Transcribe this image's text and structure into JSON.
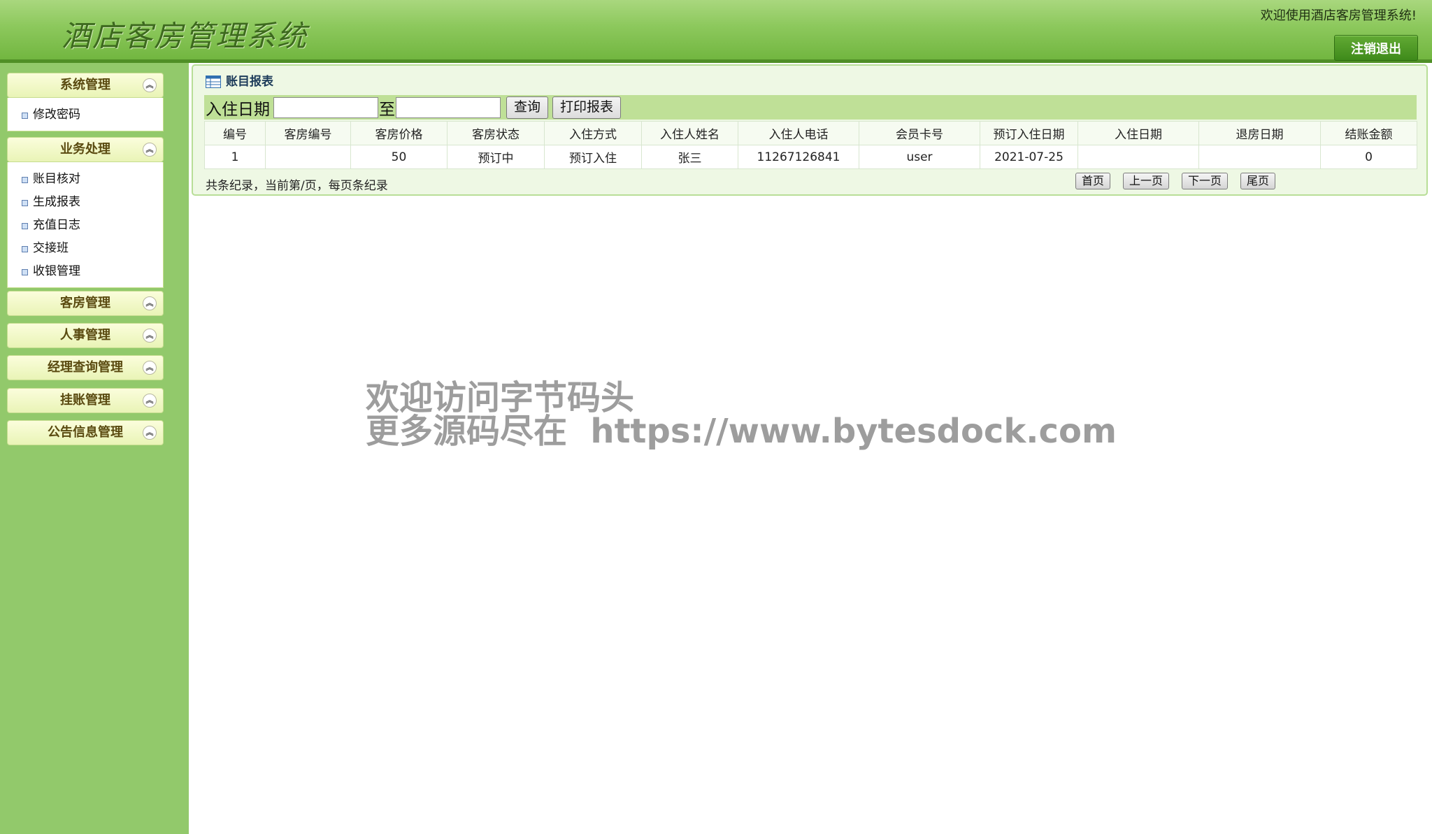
{
  "header": {
    "app_title": "酒店客房管理系统",
    "welcome": "欢迎使用酒店客房管理系统!",
    "logout": "注销退出"
  },
  "sidebar": {
    "groups": [
      {
        "label": "系统管理",
        "items": [
          "修改密码"
        ]
      },
      {
        "label": "业务处理",
        "items": [
          "账目核对",
          "生成报表",
          "充值日志",
          "交接班",
          "收银管理"
        ]
      },
      {
        "label": "客房管理",
        "items": []
      },
      {
        "label": "人事管理",
        "items": []
      },
      {
        "label": "经理查询管理",
        "items": []
      },
      {
        "label": "挂账管理",
        "items": []
      },
      {
        "label": "公告信息管理",
        "items": []
      }
    ]
  },
  "panel": {
    "title": "账目报表",
    "search": {
      "label": "入住日期",
      "separator": "至",
      "start_value": "",
      "end_value": "",
      "query_button": "查询",
      "print_button": "打印报表"
    },
    "table": {
      "columns": [
        "编号",
        "客房编号",
        "客房价格",
        "客房状态",
        "入住方式",
        "入住人姓名",
        "入住人电话",
        "会员卡号",
        "预订入住日期",
        "入住日期",
        "退房日期",
        "结账金额"
      ],
      "rows": [
        [
          "1",
          "",
          "50",
          "预订中",
          "预订入住",
          "张三",
          "11267126841",
          "user",
          "2021-07-25",
          "",
          "",
          "0"
        ]
      ]
    },
    "pager": {
      "summary": "共条纪录，当前第/页，每页条纪录",
      "first": "首页",
      "prev": "上一页",
      "next": "下一页",
      "last": "尾页"
    }
  },
  "watermark": {
    "line1": "欢迎访问字节码头",
    "line2": "更多源码尽在  https://www.bytesdock.com"
  },
  "colors": {
    "header_green": "#8cc85c",
    "sidebar_green": "#92c96b",
    "logout_green": "#4e9a26"
  }
}
